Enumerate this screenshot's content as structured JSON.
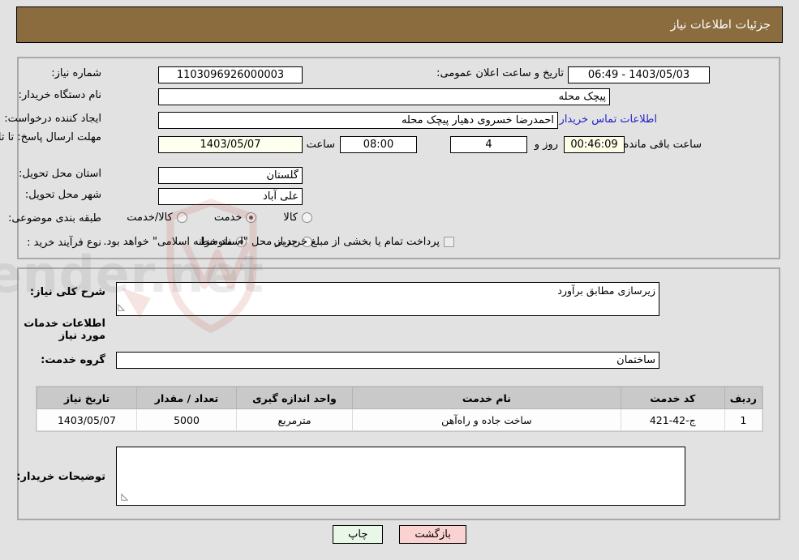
{
  "header": {
    "title": "جزئیات اطلاعات نیاز"
  },
  "main_section": {
    "need_number": {
      "label": "شماره نیاز:",
      "value": "1103096926000003"
    },
    "public_announce": {
      "label": "تاریخ و ساعت اعلان عمومی:",
      "value": "1403/05/03 - 06:49"
    },
    "buyer_org": {
      "label": "نام دستگاه خریدار:",
      "value": "پیچک محله"
    },
    "request_creator": {
      "label": "ایجاد کننده درخواست:",
      "value": "احمدرضا خسروی دهیار پیچک محله"
    },
    "contact_link": "اطلاعات تماس خریدار",
    "deadline": {
      "label": "مهلت ارسال پاسخ: تا تاریخ:",
      "date": "1403/05/07",
      "time_label": "ساعت",
      "time": "08:00",
      "days": "4",
      "days_label": "روز و",
      "countdown": "00:46:09",
      "countdown_label": "ساعت باقی مانده"
    },
    "province": {
      "label": "استان محل تحویل:",
      "value": "گلستان"
    },
    "city": {
      "label": "شهر محل تحویل:",
      "value": "علی آباد"
    },
    "subject_category": {
      "label": "طبقه بندی موضوعی:",
      "options": [
        "کالا",
        "خدمت",
        "کالا/خدمت"
      ],
      "selected": "خدمت"
    },
    "purchase_type": {
      "label": "نوع فرآیند خرید :",
      "options": [
        "جزیی",
        "متوسط"
      ],
      "selected": "متوسط",
      "checkbox_label": "پرداخت تمام یا بخشی از مبلغ خرید،از محل \"اسناد خزانه اسلامی\" خواهد بود.",
      "checkbox_checked": false
    }
  },
  "detail_section": {
    "general_desc": {
      "label": "شرح کلی نیاز:",
      "value": "زیرسازی مطابق برآورد"
    },
    "services_title": "اطلاعات خدمات مورد نیاز",
    "service_group": {
      "label": "گروه خدمت:",
      "value": "ساختمان"
    },
    "table": {
      "headers": [
        "ردیف",
        "کد خدمت",
        "نام خدمت",
        "واحد اندازه گیری",
        "تعداد / مقدار",
        "تاریخ نیاز"
      ],
      "rows": [
        {
          "row_no": "1",
          "service_code": "ج-42-421",
          "service_name": "ساخت جاده و راه‌آهن",
          "unit": "مترمربع",
          "quantity": "5000",
          "need_date": "1403/05/07"
        }
      ]
    },
    "buyer_notes": {
      "label": "توضیحات خریدار:",
      "value": ""
    }
  },
  "footer": {
    "print_button": "چاپ",
    "back_button": "بازگشت"
  },
  "colors": {
    "header_brown": "#8a6c3e",
    "link_blue": "#2222cc",
    "table_header_gray": "#c9c9c9",
    "back_button_pink": "#fad2d2",
    "print_button_green": "#e9f7e9"
  }
}
